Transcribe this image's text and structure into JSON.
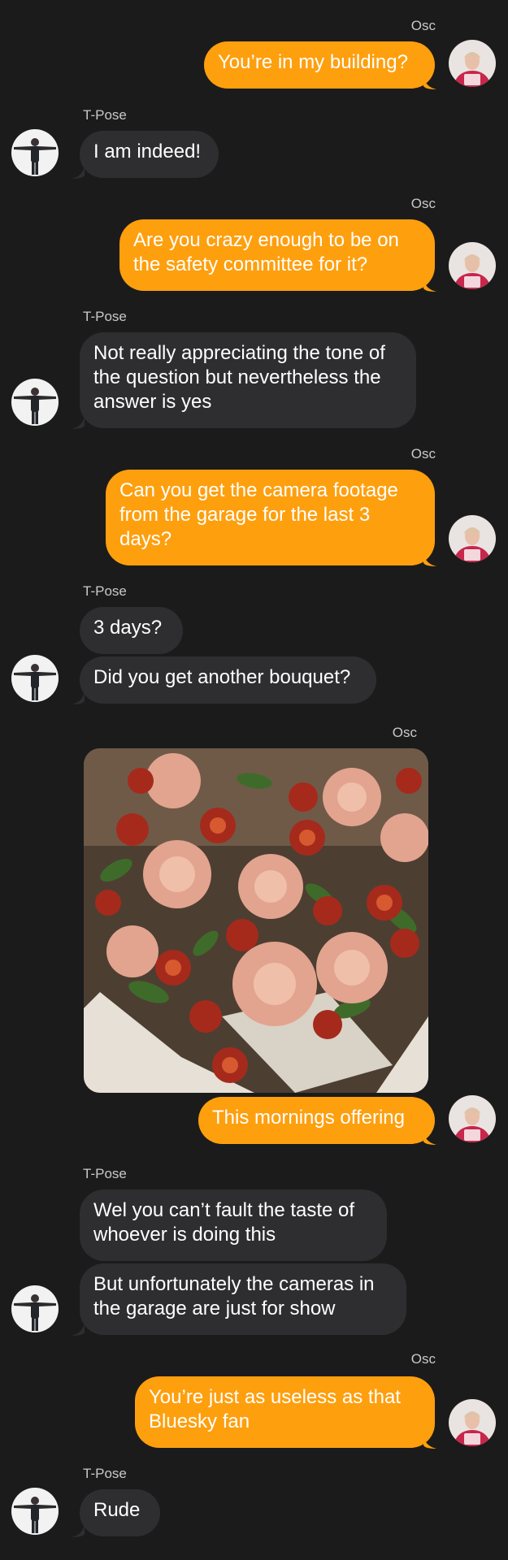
{
  "colors": {
    "background": "#1b1b1c",
    "outgoing_bubble": "#fe9f0e",
    "incoming_bubble": "#2e2e30"
  },
  "participants": {
    "me": "Osc",
    "them": "T-Pose"
  },
  "messages": [
    {
      "sender": "Osc",
      "text": "You’re in my building?"
    },
    {
      "sender": "T-Pose",
      "text": "I am indeed!"
    },
    {
      "sender": "Osc",
      "text": "Are you crazy enough to be on the safety committee for it?"
    },
    {
      "sender": "T-Pose",
      "text": "Not really appreciating the tone of the question but nevertheless the answer is yes"
    },
    {
      "sender": "Osc",
      "text": "Can you get the camera footage from the garage for the last 3 days?"
    },
    {
      "sender": "T-Pose",
      "text": "3 days?"
    },
    {
      "sender": "T-Pose",
      "text": "Did you get another bouquet?"
    },
    {
      "sender": "Osc",
      "type": "image",
      "subject": "bouquet of roses wrapped in newspaper"
    },
    {
      "sender": "Osc",
      "text": "This mornings offering"
    },
    {
      "sender": "T-Pose",
      "text": "Wel you can’t fault the taste of whoever is doing this"
    },
    {
      "sender": "T-Pose",
      "text": "But unfortunately the cameras in the garage are just for show"
    },
    {
      "sender": "Osc",
      "text": "You’re just as useless as that Bluesky fan"
    },
    {
      "sender": "T-Pose",
      "text": "Rude"
    }
  ]
}
